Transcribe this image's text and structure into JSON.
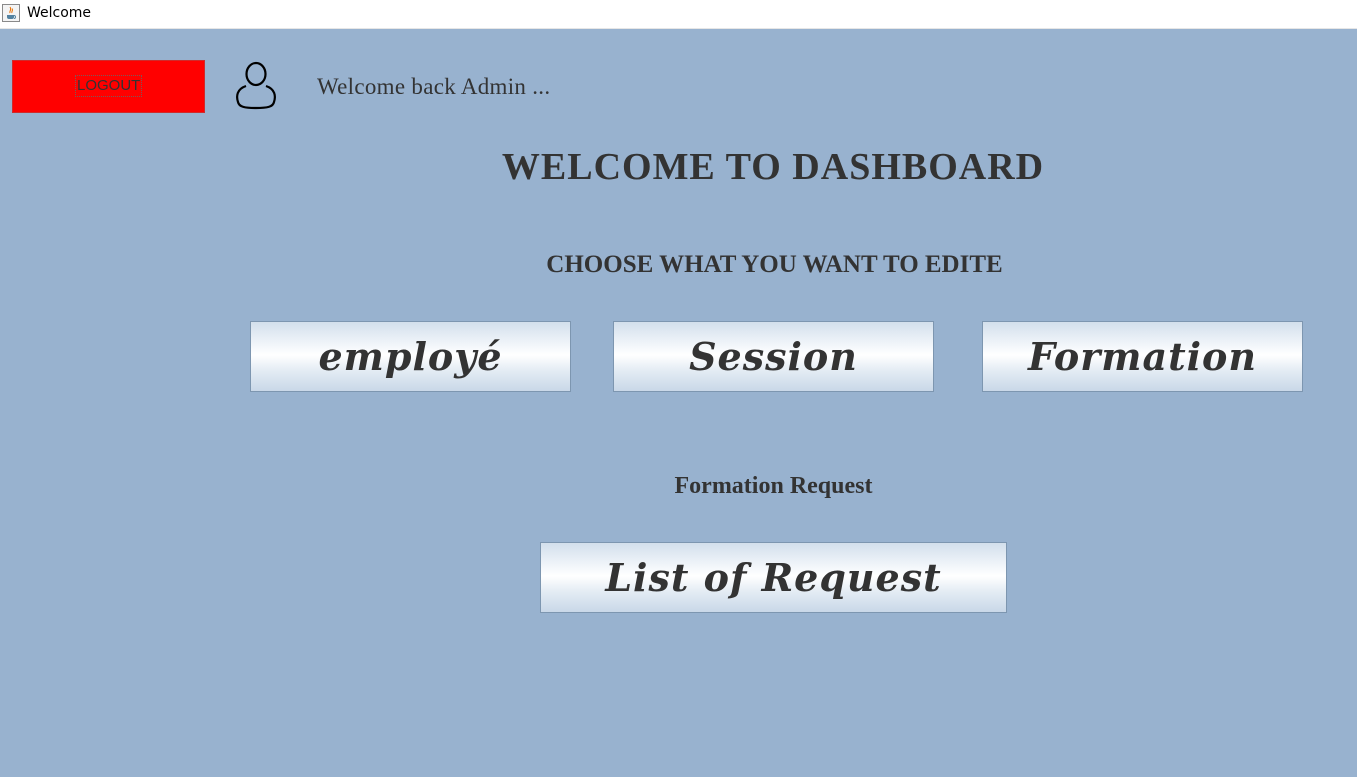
{
  "window": {
    "title": "Welcome",
    "icon": "java-cup-icon"
  },
  "header": {
    "logout_label": "LOGOUT",
    "user_icon": "user-icon",
    "welcome_text": "Welcome back Admin ..."
  },
  "main": {
    "title": "WELCOME TO DASHBOARD",
    "choose_text": "CHOOSE WHAT YOU WANT TO EDITE",
    "buttons": [
      {
        "label": "employé"
      },
      {
        "label": "Session"
      },
      {
        "label": "Formation"
      }
    ],
    "request_section_label": "Formation Request",
    "request_button_label": "List of Request"
  },
  "colors": {
    "background": "#98b2cf",
    "logout_button": "#ff0000",
    "text": "#333333"
  }
}
